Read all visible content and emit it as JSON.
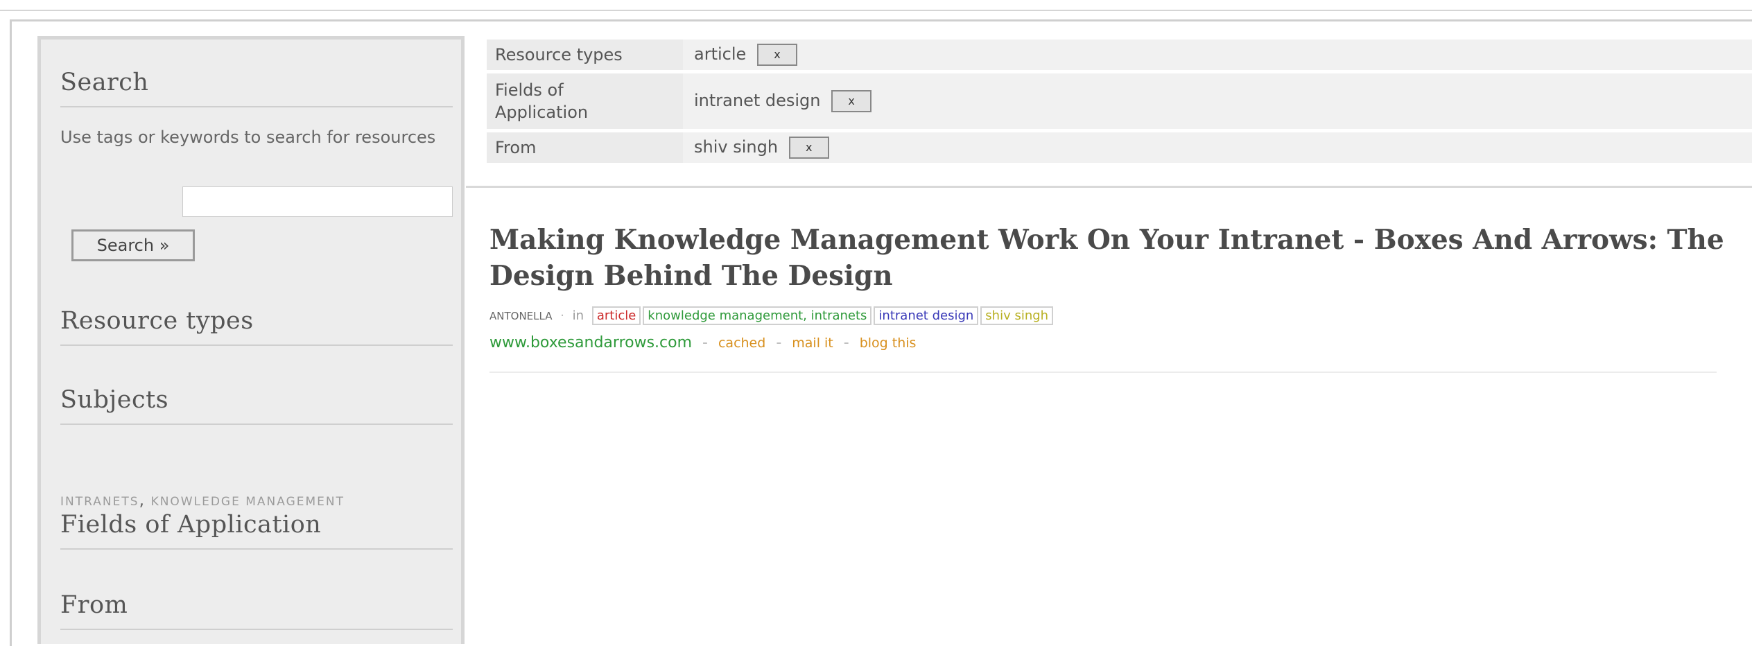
{
  "sidebar": {
    "search_heading": "Search",
    "search_description": "Use tags or keywords to search for resources",
    "search_input_value": "",
    "search_button_label": "Search »",
    "resource_types_heading": "Resource types",
    "subjects_heading": "Subjects",
    "subject_tags": [
      "INTRANETS",
      "KNOWLEDGE MANAGEMENT"
    ],
    "subject_separator": ",",
    "fields_heading": "Fields of Application",
    "from_heading": "From"
  },
  "filters": [
    {
      "label": "Resource types",
      "value": "article",
      "remove_label": "x"
    },
    {
      "label": "Fields of Application",
      "value": "intranet design",
      "remove_label": "x"
    },
    {
      "label": "From",
      "value": "shiv singh",
      "remove_label": "x"
    }
  ],
  "result": {
    "title": "Making Knowledge Management Work On Your Intranet - Boxes And Arrows: The Design Behind The Design",
    "author": "ANTONELLA",
    "in_label": "in",
    "separator": "·",
    "tags": [
      {
        "text": "article",
        "color": "#cc2a2a"
      },
      {
        "text": "knowledge management, intranets",
        "color": "#2f9a3a"
      },
      {
        "text": "intranet design",
        "color": "#3a3ab8"
      },
      {
        "text": "shiv singh",
        "color": "#b8b022"
      }
    ],
    "url": "www.boxesandarrows.com",
    "actions": [
      "cached",
      "mail it",
      "blog this"
    ],
    "action_separator": "-"
  },
  "colors": {
    "sidebar_bg": "#ededed",
    "url_green": "#2e9a3a",
    "action_orange": "#d8901e"
  }
}
